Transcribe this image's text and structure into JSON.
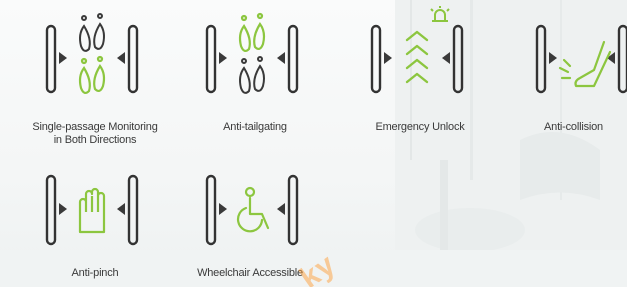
{
  "colors": {
    "accent_green": "#8cc63f",
    "icon_dark": "#3a3a3a",
    "pole_stroke": "#333333",
    "text": "#3a3a3a"
  },
  "features": [
    {
      "id": "single-passage",
      "icon": "two-directions-footprints-icon",
      "caption_lines": [
        "Single-passage Monitoring",
        "in Both Directions"
      ]
    },
    {
      "id": "anti-tailgating",
      "icon": "tailgating-footprints-icon",
      "caption_lines": [
        "Anti-tailgating"
      ]
    },
    {
      "id": "emergency-unlock",
      "icon": "emergency-chevrons-alarm-icon",
      "caption_lines": [
        "Emergency Unlock"
      ]
    },
    {
      "id": "anti-collision",
      "icon": "collision-leg-icon",
      "caption_lines": [
        "Anti-collision"
      ]
    },
    {
      "id": "anti-pinch",
      "icon": "hand-icon",
      "caption_lines": [
        "Anti-pinch"
      ]
    },
    {
      "id": "wheelchair-accessible",
      "icon": "wheelchair-icon",
      "caption_lines": [
        "Wheelchair Accessible"
      ]
    }
  ],
  "watermark": {
    "text": "ky"
  }
}
